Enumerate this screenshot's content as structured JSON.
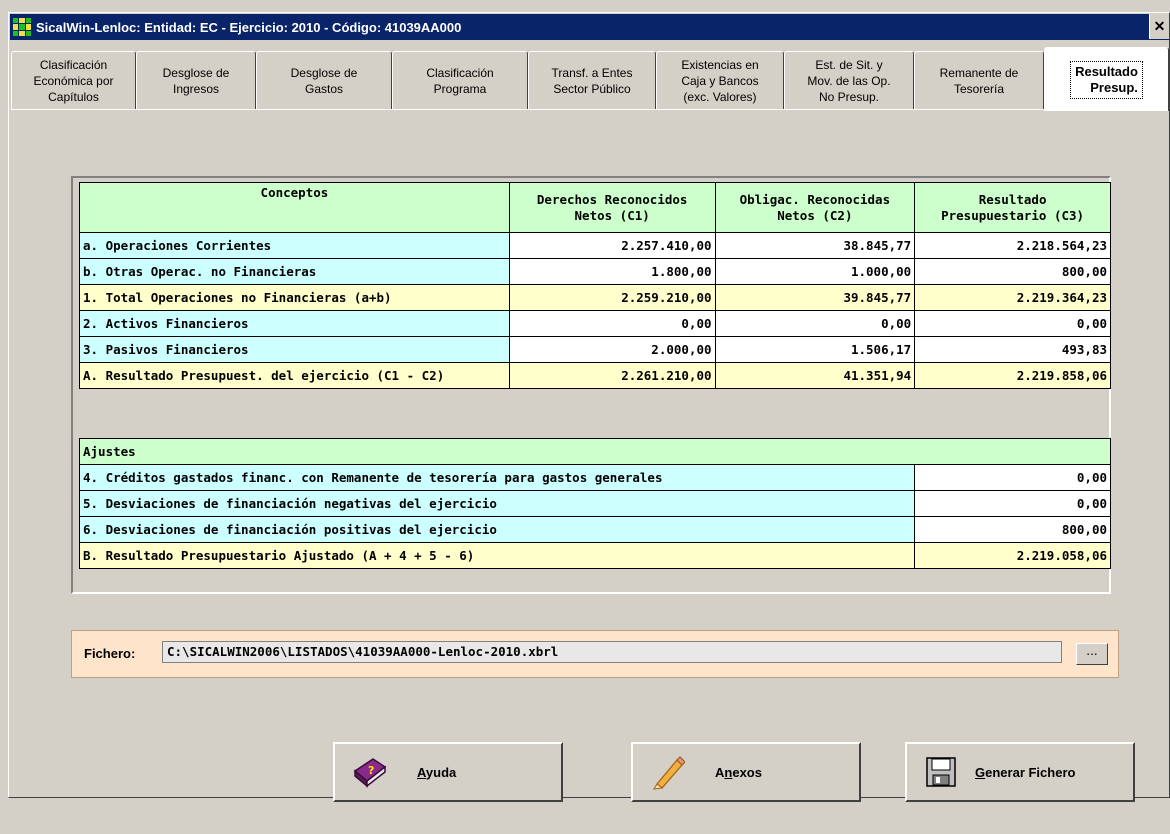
{
  "window": {
    "title": "SicalWin-Lenloc: Entidad: EC - Ejercicio: 2010 - Código: 41039AA000",
    "close_label": "✕"
  },
  "tabs": [
    {
      "label": "Clasificación\nEconómica por\nCapítulos"
    },
    {
      "label": "Desglose de\nIngresos"
    },
    {
      "label": "Desglose de\nGastos"
    },
    {
      "label": "Clasificación\nPrograma"
    },
    {
      "label": "Transf. a Entes\nSector Público"
    },
    {
      "label": "Existencias en\nCaja y Bancos\n(exc. Valores)"
    },
    {
      "label": "Est. de Sit. y\nMov. de las Op.\nNo Presup."
    },
    {
      "label": "Remanente de\nTesorería"
    },
    {
      "label": "Resultado\nPresup.",
      "active": true
    }
  ],
  "main_table": {
    "headers": [
      "Conceptos",
      "Derechos Reconocidos\nNetos (C1)",
      "Obligac. Reconocidas\nNetos (C2)",
      "Resultado\nPresupuestario (C3)"
    ],
    "rows": [
      {
        "concept": "a. Operaciones Corrientes",
        "c1": "2.257.410,00",
        "c2": "38.845,77",
        "c3": "2.218.564,23",
        "kind": "cyan"
      },
      {
        "concept": "b. Otras Operac. no Financieras",
        "c1": "1.800,00",
        "c2": "1.000,00",
        "c3": "800,00",
        "kind": "cyan"
      },
      {
        "concept": "1. Total Operaciones no Financieras (a+b)",
        "c1": "2.259.210,00",
        "c2": "39.845,77",
        "c3": "2.219.364,23",
        "kind": "yellow"
      },
      {
        "concept": "2. Activos Financieros",
        "c1": "0,00",
        "c2": "0,00",
        "c3": "0,00",
        "kind": "cyan"
      },
      {
        "concept": "3. Pasivos Financieros",
        "c1": "2.000,00",
        "c2": "1.506,17",
        "c3": "493,83",
        "kind": "cyan"
      },
      {
        "concept": "A. Resultado Presupuest. del ejercicio (C1 - C2)",
        "c1": "2.261.210,00",
        "c2": "41.351,94",
        "c3": "2.219.858,06",
        "kind": "yellow"
      }
    ]
  },
  "adjust_table": {
    "header": "Ajustes",
    "rows": [
      {
        "concept": "4. Créditos gastados financ. con Remanente de tesorería para gastos generales",
        "value": "0,00",
        "kind": "cyan"
      },
      {
        "concept": "5. Desviaciones de financiación negativas del ejercicio",
        "value": "0,00",
        "kind": "cyan"
      },
      {
        "concept": "6. Desviaciones de financiación positivas del ejercicio",
        "value": "800,00",
        "kind": "cyan"
      },
      {
        "concept": "B. Resultado Presupuestario Ajustado (A + 4 + 5 - 6)",
        "value": "2.219.058,06",
        "kind": "yellow"
      }
    ]
  },
  "fichero": {
    "label": "Fichero:",
    "value": "C:\\SICALWIN2006\\LISTADOS\\41039AA000-Lenloc-2010.xbrl",
    "browse_label": "..."
  },
  "buttons": {
    "ayuda": {
      "accel": "A",
      "rest": "yuda"
    },
    "anexos": {
      "pre": "A",
      "accel": "n",
      "rest": "exos"
    },
    "generar": {
      "accel": "G",
      "rest": "enerar Fichero"
    }
  },
  "colors": {
    "green": "#ccffcc",
    "cyan": "#ccffff",
    "yellow": "#ffffcc",
    "title_bar": "#0a246a"
  }
}
